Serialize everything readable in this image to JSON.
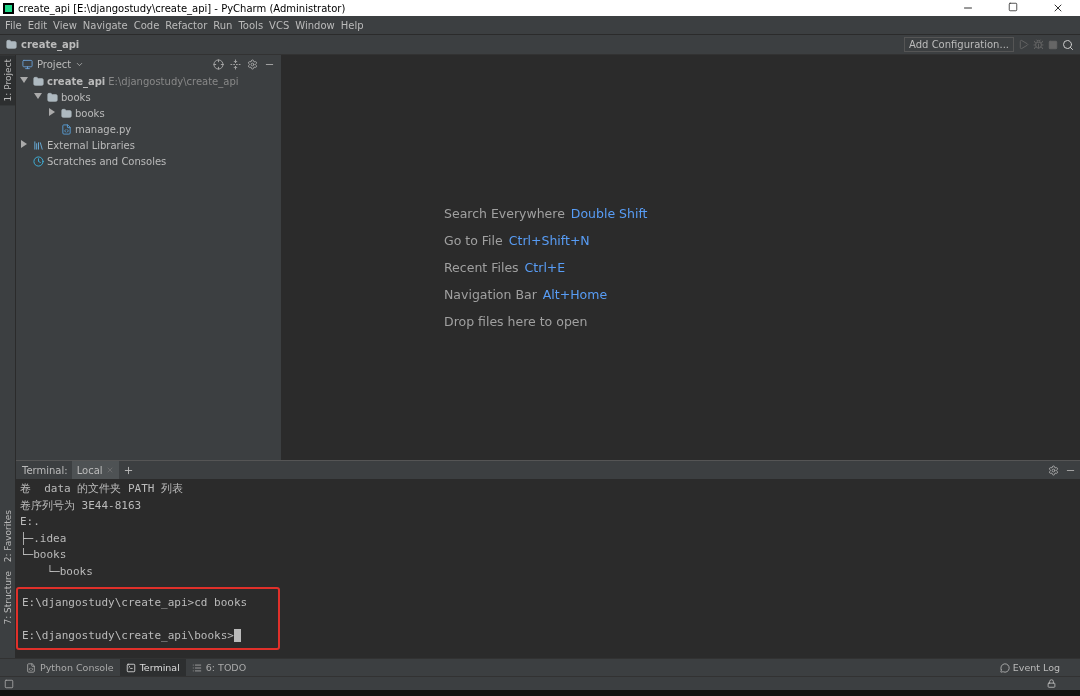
{
  "window": {
    "title": "create_api [E:\\djangostudy\\create_api] - PyCharm (Administrator)"
  },
  "menu": [
    "File",
    "Edit",
    "View",
    "Navigate",
    "Code",
    "Refactor",
    "Run",
    "Tools",
    "VCS",
    "Window",
    "Help"
  ],
  "breadcrumb": "create_api",
  "run_config": "Add Configuration...",
  "side_tabs_top": [
    {
      "label": "1: Project",
      "selected": true
    }
  ],
  "side_tabs_bottom": [
    {
      "label": "2: Favorites",
      "selected": false
    },
    {
      "label": "7: Structure",
      "selected": false
    }
  ],
  "project_panel": {
    "title": "Project",
    "tree": [
      {
        "label": "create_api",
        "path": "E:\\djangostudy\\create_api",
        "kind": "folder",
        "expanded": true,
        "children": [
          {
            "label": "books",
            "kind": "folder",
            "expanded": true,
            "children": [
              {
                "label": "books",
                "kind": "folder",
                "expanded": false
              },
              {
                "label": "manage.py",
                "kind": "python"
              }
            ]
          }
        ]
      },
      {
        "label": "External Libraries",
        "kind": "library",
        "expanded": false
      },
      {
        "label": "Scratches and Consoles",
        "kind": "scratch"
      }
    ]
  },
  "editor_hints": [
    {
      "label": "Search Everywhere",
      "shortcut": "Double Shift"
    },
    {
      "label": "Go to File",
      "shortcut": "Ctrl+Shift+N"
    },
    {
      "label": "Recent Files",
      "shortcut": "Ctrl+E"
    },
    {
      "label": "Navigation Bar",
      "shortcut": "Alt+Home"
    },
    {
      "label": "Drop files here to open"
    }
  ],
  "terminal": {
    "title": "Terminal:",
    "tabs": [
      {
        "label": "Local",
        "selected": true
      }
    ],
    "output": [
      "卷  data 的文件夹 PATH 列表",
      "卷序列号为 3E44-8163",
      "E:.",
      "├─.idea",
      "└─books",
      "    └─books"
    ],
    "highlighted": [
      "E:\\djangostudy\\create_api>cd books",
      "E:\\djangostudy\\create_api\\books>"
    ]
  },
  "bottom_tabs": [
    {
      "label": "Python Console",
      "selected": false,
      "kind": "python"
    },
    {
      "label": "Terminal",
      "selected": true,
      "kind": "terminal"
    },
    {
      "label": "6: TODO",
      "selected": false,
      "kind": "todo"
    }
  ],
  "event_log": "Event Log"
}
